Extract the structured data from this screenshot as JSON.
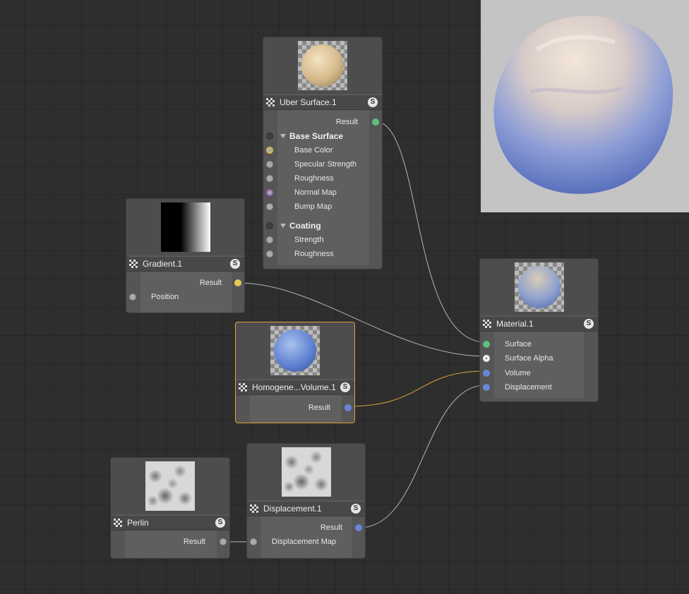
{
  "nodes": {
    "uber": {
      "title": "Uber Surface.1",
      "s": "S",
      "result": "Result",
      "section1": "Base Surface",
      "inputs1": [
        "Base Color",
        "Specular Strength",
        "Roughness",
        "Normal Map",
        "Bump Map"
      ],
      "section2": "Coating",
      "inputs2": [
        "Strength",
        "Roughness"
      ]
    },
    "gradient": {
      "title": "Gradient.1",
      "s": "S",
      "result": "Result",
      "input": "Position"
    },
    "homog": {
      "title": "Homogene...Volume.1",
      "s": "S",
      "result": "Result"
    },
    "material": {
      "title": "Material.1",
      "s": "S",
      "inputs": [
        "Surface",
        "Surface Alpha",
        "Volume",
        "Displacement"
      ]
    },
    "perlin": {
      "title": "Perlin",
      "s": "S",
      "result": "Result"
    },
    "displacement": {
      "title": "Displacement.1",
      "s": "S",
      "result": "Result",
      "input": "Displacement Map"
    }
  },
  "colors": {
    "selection": "#d9a23a",
    "wire": "#b5b5b5",
    "wire_selected": "#d9a23a",
    "port_surface": "#5cc17a",
    "port_volume": "#6a86d8",
    "port_color": "#e4c85c",
    "port_normal": "#9165c2"
  },
  "icons": {
    "node": "checker-node-icon",
    "solo": "s-badge-icon",
    "section": "triangle-down-icon"
  }
}
